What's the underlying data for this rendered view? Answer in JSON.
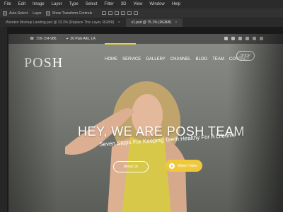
{
  "photoshop": {
    "menu": [
      "File",
      "Edit",
      "Image",
      "Layer",
      "Type",
      "Select",
      "Filter",
      "3D",
      "View",
      "Window",
      "Help"
    ],
    "options": {
      "auto_select": "Auto-Select:",
      "layer_select": "Layer",
      "show_transform": "Show Transform Controls"
    },
    "tabs": [
      {
        "label": "Wooden Mockup Landing.psd @ 33.3% (Replace This Layer, RGB/8)",
        "active": false
      },
      {
        "label": "v1.psd @ 75.1% (RGB/8)",
        "active": true
      }
    ]
  },
  "site": {
    "phone": "298-154-986",
    "address": "20 Palo Alto, LA",
    "logo": "POSH",
    "nav": [
      "HOME",
      "SERVICE",
      "GALLERY",
      "CHANNEL",
      "BLOG",
      "TEAM",
      "CONTACT"
    ],
    "shop": "SHOP",
    "hero_title": "HEY, WE ARE POSH TEAM",
    "hero_sub": "Seven Steps For Keeping Teeth Healthy For A Lifetime",
    "btn_about": "About Us",
    "btn_video": "Watch Video"
  },
  "colors": {
    "accent": "#f0c93a",
    "ps_dark": "#2b2b2b"
  }
}
